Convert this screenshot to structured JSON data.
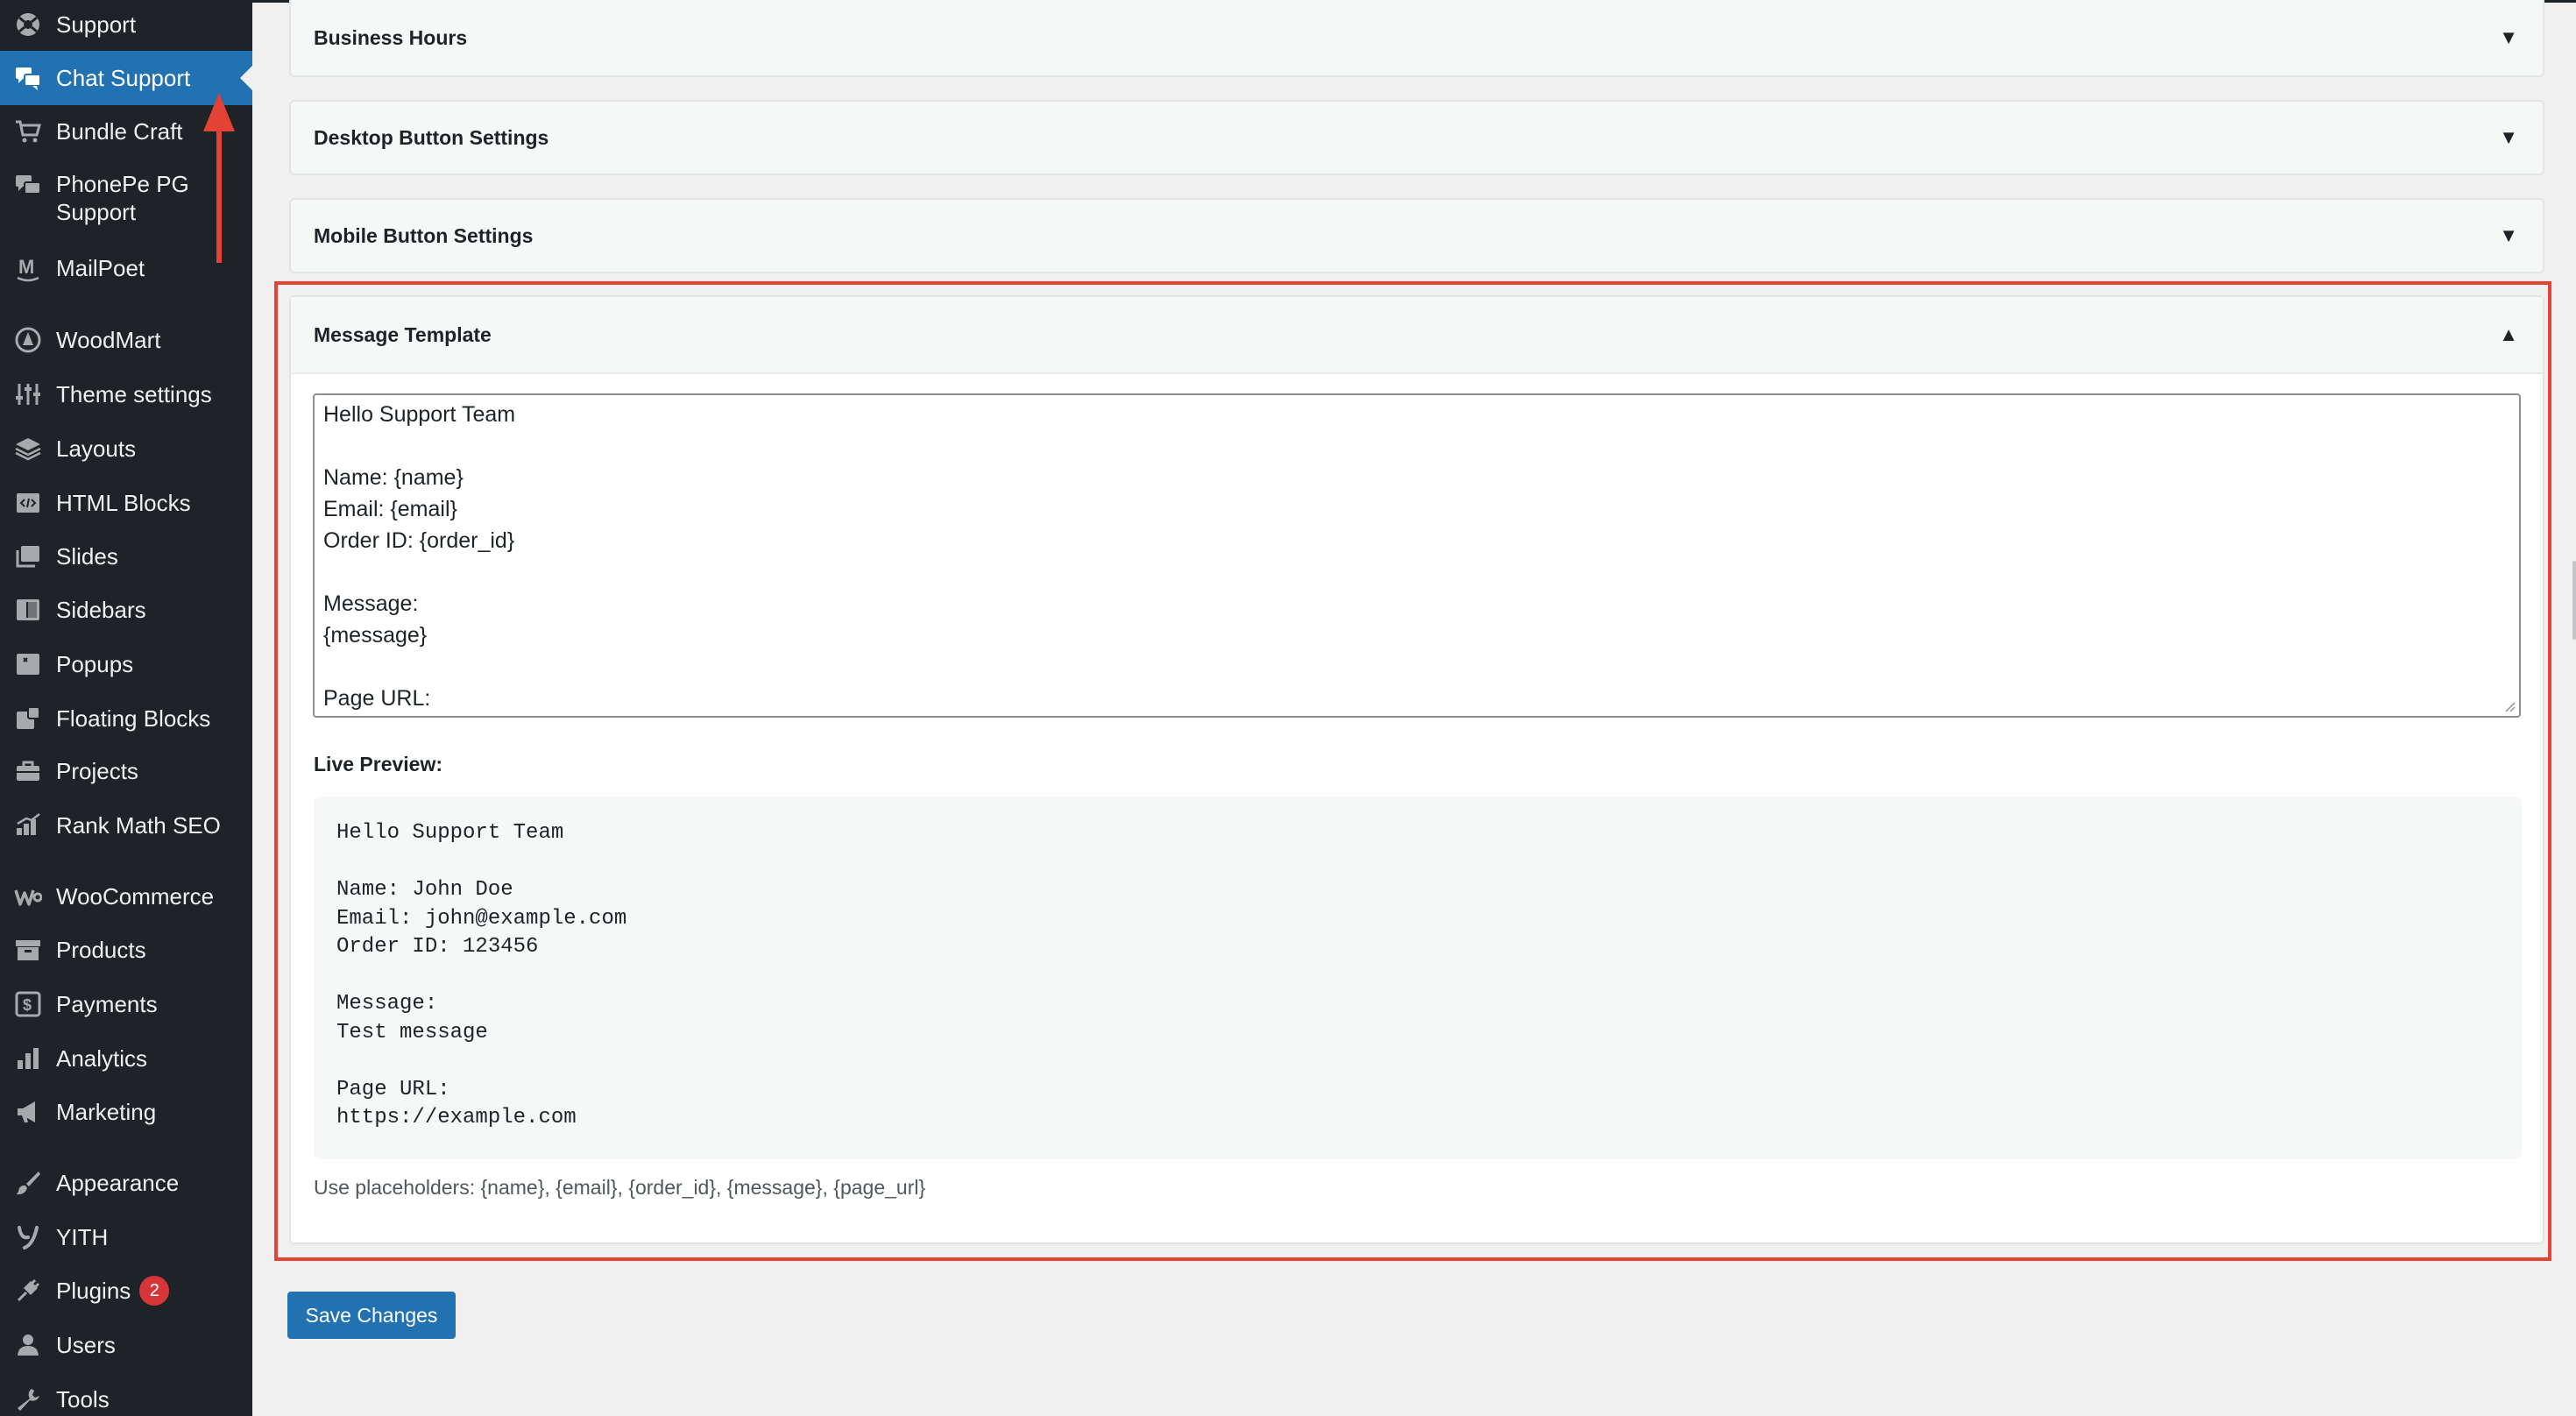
{
  "sidebar": {
    "items": [
      {
        "label": "Support",
        "icon": "support-icon"
      },
      {
        "label": "Chat Support",
        "icon": "chat-bubbles-icon",
        "active": true
      },
      {
        "label": "Bundle Craft",
        "icon": "cart-icon"
      },
      {
        "label": "PhonePe PG Support",
        "icon": "chat-bubbles-icon"
      },
      {
        "label": "MailPoet",
        "icon": "mailpoet-icon"
      },
      {
        "label": "WoodMart",
        "icon": "woodmart-icon"
      },
      {
        "label": "Theme settings",
        "icon": "sliders-icon"
      },
      {
        "label": "Layouts",
        "icon": "layers-icon"
      },
      {
        "label": "HTML Blocks",
        "icon": "code-block-icon"
      },
      {
        "label": "Slides",
        "icon": "slides-icon"
      },
      {
        "label": "Sidebars",
        "icon": "sidebar-layout-icon"
      },
      {
        "label": "Popups",
        "icon": "popup-icon"
      },
      {
        "label": "Floating Blocks",
        "icon": "floating-blocks-icon"
      },
      {
        "label": "Projects",
        "icon": "briefcase-icon"
      },
      {
        "label": "Rank Math SEO",
        "icon": "rank-math-icon"
      },
      {
        "label": "WooCommerce",
        "icon": "woocommerce-icon"
      },
      {
        "label": "Products",
        "icon": "archive-icon"
      },
      {
        "label": "Payments",
        "icon": "payments-icon"
      },
      {
        "label": "Analytics",
        "icon": "bar-chart-icon"
      },
      {
        "label": "Marketing",
        "icon": "megaphone-icon"
      },
      {
        "label": "Appearance",
        "icon": "paintbrush-icon"
      },
      {
        "label": "YITH",
        "icon": "yith-icon"
      },
      {
        "label": "Plugins",
        "icon": "plug-icon",
        "badge": "2"
      },
      {
        "label": "Users",
        "icon": "user-icon"
      },
      {
        "label": "Tools",
        "icon": "wrench-icon"
      }
    ]
  },
  "panels": {
    "business_hours": "Business Hours",
    "desktop_button": "Desktop Button Settings",
    "mobile_button": "Mobile Button Settings",
    "message_template": "Message Template"
  },
  "carets": {
    "collapsed": "▼",
    "expanded": "▲"
  },
  "template": {
    "lines": [
      "Hello Support Team",
      "",
      "Name: {name}",
      "Email: {email}",
      "Order ID: {order_id}",
      "",
      "Message:",
      "{message}",
      "",
      "Page URL:"
    ]
  },
  "preview": {
    "label": "Live Preview:",
    "lines": [
      "Hello Support Team",
      "",
      "Name: John Doe",
      "Email: john@example.com",
      "Order ID: 123456",
      "",
      "Message:",
      "Test message",
      "",
      "Page URL:",
      "https://example.com"
    ]
  },
  "help_text": "Use placeholders: {name}, {email}, {order_id}, {message}, {page_url}",
  "save_label": "Save Changes",
  "colors": {
    "sidebar_bg": "#1d2327",
    "active_bg": "#2271b1",
    "highlight": "#e34234",
    "badge": "#d63638"
  }
}
